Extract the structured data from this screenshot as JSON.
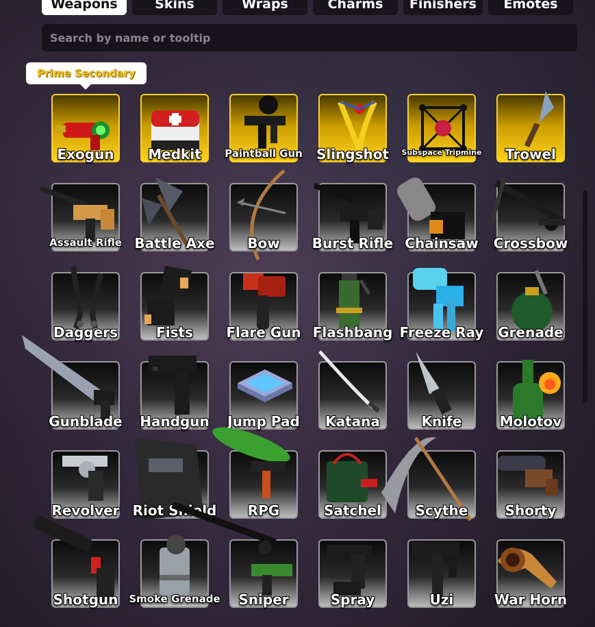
{
  "tabs": [
    {
      "label": "Weapons",
      "active": true
    },
    {
      "label": "Skins",
      "active": false
    },
    {
      "label": "Wraps",
      "active": false
    },
    {
      "label": "Charms",
      "active": false
    },
    {
      "label": "Finishers",
      "active": false
    },
    {
      "label": "Emotes",
      "active": false
    }
  ],
  "search": {
    "placeholder": "Search by name or tooltip",
    "value": ""
  },
  "tooltip": {
    "text": "Prime Secondary"
  },
  "colors": {
    "prime_gold": "#f7d02b",
    "card_border": "#9a9a9a",
    "accent_white": "#ffffff"
  },
  "weapons": [
    {
      "name": "Exogun",
      "icon": "exogun-icon",
      "prime": true
    },
    {
      "name": "Medkit",
      "icon": "medkit-icon",
      "prime": true
    },
    {
      "name": "Paintball Gun",
      "icon": "paintball-gun-icon",
      "prime": true
    },
    {
      "name": "Slingshot",
      "icon": "slingshot-icon",
      "prime": true
    },
    {
      "name": "Subspace Tripmine",
      "icon": "subspace-tripmine-icon",
      "prime": true
    },
    {
      "name": "Trowel",
      "icon": "trowel-icon",
      "prime": true
    },
    {
      "name": "Assault Rifle",
      "icon": "assault-rifle-icon",
      "prime": false
    },
    {
      "name": "Battle Axe",
      "icon": "battle-axe-icon",
      "prime": false
    },
    {
      "name": "Bow",
      "icon": "bow-icon",
      "prime": false
    },
    {
      "name": "Burst Rifle",
      "icon": "burst-rifle-icon",
      "prime": false
    },
    {
      "name": "Chainsaw",
      "icon": "chainsaw-icon",
      "prime": false
    },
    {
      "name": "Crossbow",
      "icon": "crossbow-icon",
      "prime": false
    },
    {
      "name": "Daggers",
      "icon": "daggers-icon",
      "prime": false
    },
    {
      "name": "Fists",
      "icon": "fists-icon",
      "prime": false
    },
    {
      "name": "Flare Gun",
      "icon": "flare-gun-icon",
      "prime": false
    },
    {
      "name": "Flashbang",
      "icon": "flashbang-icon",
      "prime": false
    },
    {
      "name": "Freeze Ray",
      "icon": "freeze-ray-icon",
      "prime": false
    },
    {
      "name": "Grenade",
      "icon": "grenade-icon",
      "prime": false
    },
    {
      "name": "Gunblade",
      "icon": "gunblade-icon",
      "prime": false
    },
    {
      "name": "Handgun",
      "icon": "handgun-icon",
      "prime": false
    },
    {
      "name": "Jump Pad",
      "icon": "jump-pad-icon",
      "prime": false
    },
    {
      "name": "Katana",
      "icon": "katana-icon",
      "prime": false
    },
    {
      "name": "Knife",
      "icon": "knife-icon",
      "prime": false
    },
    {
      "name": "Molotov",
      "icon": "molotov-icon",
      "prime": false
    },
    {
      "name": "Revolver",
      "icon": "revolver-icon",
      "prime": false
    },
    {
      "name": "Riot Shield",
      "icon": "riot-shield-icon",
      "prime": false
    },
    {
      "name": "RPG",
      "icon": "rpg-icon",
      "prime": false
    },
    {
      "name": "Satchel",
      "icon": "satchel-icon",
      "prime": false
    },
    {
      "name": "Scythe",
      "icon": "scythe-icon",
      "prime": false
    },
    {
      "name": "Shorty",
      "icon": "shorty-icon",
      "prime": false
    },
    {
      "name": "Shotgun",
      "icon": "shotgun-icon",
      "prime": false
    },
    {
      "name": "Smoke Grenade",
      "icon": "smoke-grenade-icon",
      "prime": false
    },
    {
      "name": "Sniper",
      "icon": "sniper-icon",
      "prime": false
    },
    {
      "name": "Spray",
      "icon": "spray-icon",
      "prime": false
    },
    {
      "name": "Uzi",
      "icon": "uzi-icon",
      "prime": false
    },
    {
      "name": "War Horn",
      "icon": "war-horn-icon",
      "prime": false
    }
  ]
}
